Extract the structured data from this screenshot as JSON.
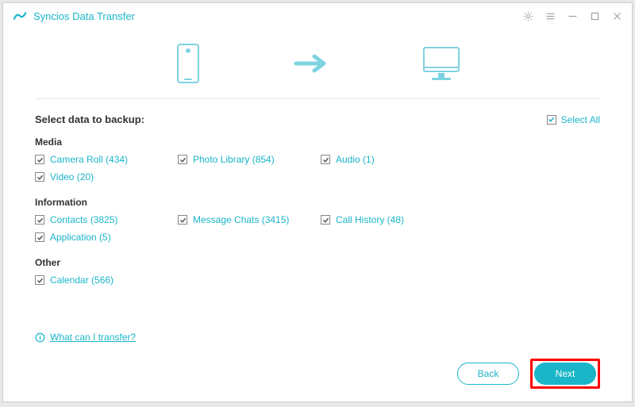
{
  "app": {
    "title": "Syncios Data Transfer"
  },
  "heading": "Select data to backup:",
  "selectAll": {
    "label": "Select All",
    "checked": true
  },
  "groups": [
    {
      "title": "Media",
      "items": [
        {
          "label": "Camera Roll (434)",
          "checked": true
        },
        {
          "label": "Photo Library (854)",
          "checked": true
        },
        {
          "label": "Audio (1)",
          "checked": true
        },
        {
          "label": "Video (20)",
          "checked": true
        }
      ]
    },
    {
      "title": "Information",
      "items": [
        {
          "label": "Contacts (3825)",
          "checked": true
        },
        {
          "label": "Message Chats (3415)",
          "checked": true
        },
        {
          "label": "Call History (48)",
          "checked": true
        },
        {
          "label": "Application (5)",
          "checked": true
        }
      ]
    },
    {
      "title": "Other",
      "items": [
        {
          "label": "Calendar (566)",
          "checked": true
        }
      ]
    }
  ],
  "help": {
    "label": "What can I transfer?"
  },
  "buttons": {
    "back": "Back",
    "next": "Next"
  }
}
